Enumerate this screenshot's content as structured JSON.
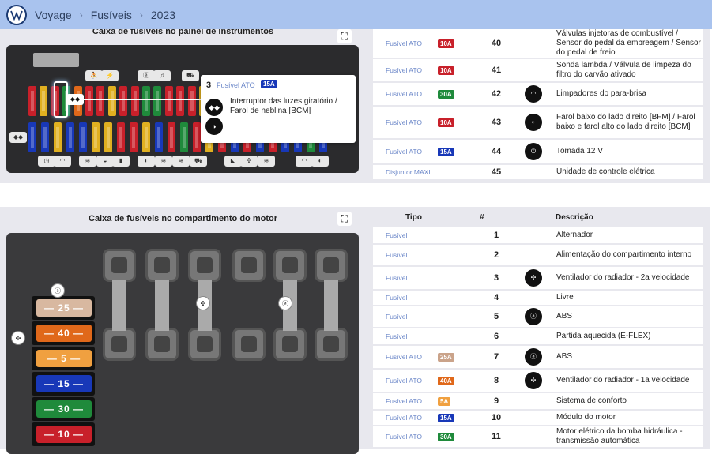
{
  "breadcrumbs": [
    "Voyage",
    "Fusíveis",
    "2023"
  ],
  "panel1": {
    "title": "Caixa de fusíveis no painel de instrumentos",
    "tooltip": {
      "number": "3",
      "type": "Fusível ATO",
      "amp": "15A",
      "description": "Interruptor das luzes giratório / Farol de neblina [BCM]",
      "icon1": "light-switch-icon",
      "icon2": "fog-light-icon"
    },
    "rows": [
      {
        "type": "Fusível ATO",
        "amp": "10A",
        "amp_color": "#c8202a",
        "num": "40",
        "icon": "",
        "desc": "Válvulas injetoras de combustível / Sensor do pedal da embreagem / Sensor do pedal de freio"
      },
      {
        "type": "Fusível ATO",
        "amp": "10A",
        "amp_color": "#c8202a",
        "num": "41",
        "icon": "",
        "desc": "Sonda lambda / Válvula de limpeza do filtro do carvão ativado"
      },
      {
        "type": "Fusível ATO",
        "amp": "30A",
        "amp_color": "#1f8a3b",
        "num": "42",
        "icon": "wiper-icon",
        "desc": "Limpadores do para-brisa"
      },
      {
        "type": "Fusível ATO",
        "amp": "10A",
        "amp_color": "#c8202a",
        "num": "43",
        "icon": "low-beam-icon",
        "desc": "Farol baixo do lado direito [BFM] / Farol baixo e farol alto do lado direito [BCM]"
      },
      {
        "type": "Fusível ATO",
        "amp": "15A",
        "amp_color": "#1838b8",
        "num": "44",
        "icon": "socket-12v-icon",
        "desc": "Tomada 12 V"
      },
      {
        "type": "Disjuntor MAXI",
        "amp": "",
        "amp_color": "",
        "num": "45",
        "icon": "",
        "desc": "Unidade de controle elétrica"
      }
    ]
  },
  "panel2": {
    "title": "Caixa de fusíveis no compartimento do motor",
    "headers": {
      "type": "Tipo",
      "num": "#",
      "desc": "Descrição"
    },
    "big_fuses": [
      {
        "label": "25",
        "color": "#d8b8a0"
      },
      {
        "label": "40",
        "color": "#e0681a"
      },
      {
        "label": "5",
        "color": "#f0a040"
      },
      {
        "label": "15",
        "color": "#1838b8"
      },
      {
        "label": "30",
        "color": "#1f8a3b"
      },
      {
        "label": "10",
        "color": "#c8202a"
      }
    ],
    "rows": [
      {
        "type": "Fusível",
        "amp": "",
        "num": "1",
        "icon": "",
        "desc": "Alternador"
      },
      {
        "type": "Fusível",
        "amp": "",
        "num": "2",
        "icon": "",
        "desc": "Alimentação do compartimento interno"
      },
      {
        "type": "Fusível",
        "amp": "",
        "num": "3",
        "icon": "fan-icon",
        "desc": "Ventilador do radiador - 2a velocidade"
      },
      {
        "type": "Fusível",
        "amp": "",
        "num": "4",
        "icon": "",
        "desc": "Livre"
      },
      {
        "type": "Fusível",
        "amp": "",
        "num": "5",
        "icon": "abs-icon",
        "desc": "ABS"
      },
      {
        "type": "Fusível",
        "amp": "",
        "num": "6",
        "icon": "",
        "desc": "Partida aquecida (E-FLEX)"
      },
      {
        "type": "Fusível ATO",
        "amp": "25A",
        "amp_color": "#caa38a",
        "num": "7",
        "icon": "abs-icon",
        "desc": "ABS"
      },
      {
        "type": "Fusível ATO",
        "amp": "40A",
        "amp_color": "#e0681a",
        "num": "8",
        "icon": "fan-icon",
        "desc": "Ventilador do radiador - 1a velocidade"
      },
      {
        "type": "Fusível ATO",
        "amp": "5A",
        "amp_color": "#f0a040",
        "num": "9",
        "icon": "",
        "desc": "Sistema de conforto"
      },
      {
        "type": "Fusível ATO",
        "amp": "15A",
        "amp_color": "#1838b8",
        "num": "10",
        "icon": "",
        "desc": "Módulo do motor"
      },
      {
        "type": "Fusível ATO",
        "amp": "30A",
        "amp_color": "#1f8a3b",
        "num": "11",
        "icon": "",
        "desc": "Motor elétrico da bomba hidráulica - transmissão automática"
      }
    ]
  },
  "icon_glyphs": {
    "wiper-icon": "◠",
    "low-beam-icon": "◐",
    "socket-12v-icon": "⏻",
    "fan-icon": "✣",
    "abs-icon": "ⓐ",
    "light-switch-icon": "◆◆",
    "fog-light-icon": "◑"
  }
}
